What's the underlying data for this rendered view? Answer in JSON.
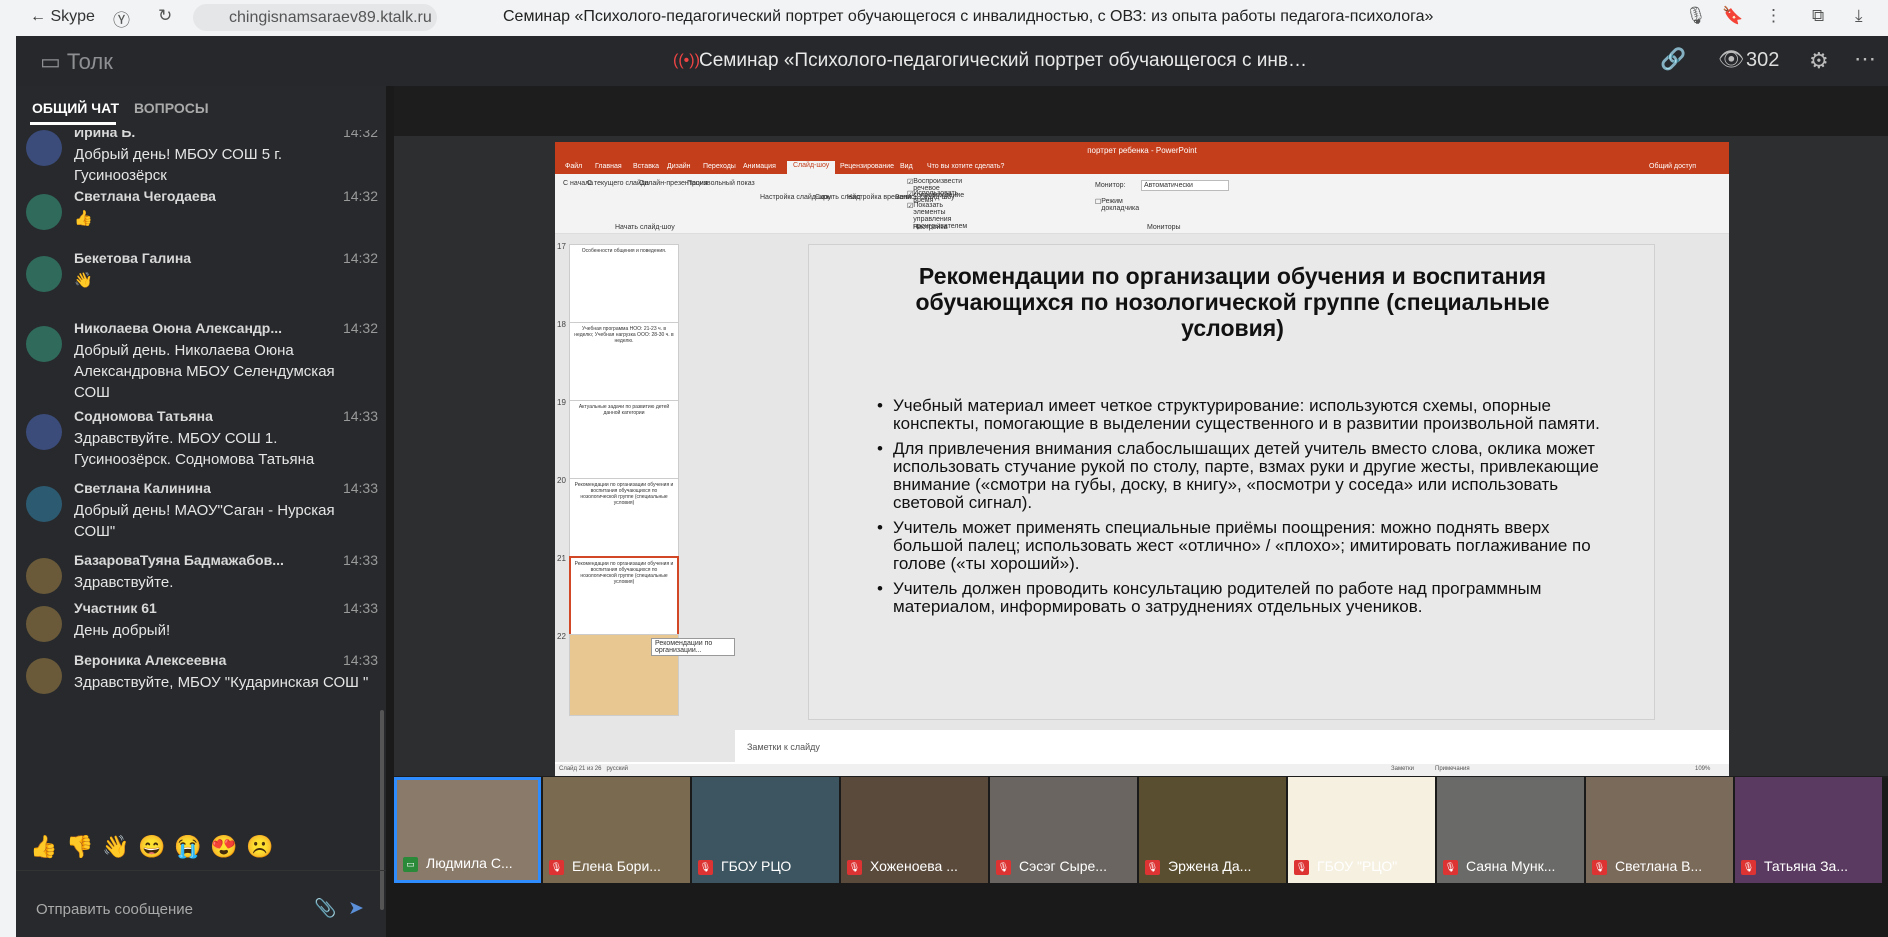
{
  "browser": {
    "back_label": "Skype",
    "url": "chingisnamsaraev89.ktalk.ru",
    "page_title": "Семинар «Психолого-педагогический портрет обучающегося с инвалидностью, с ОВЗ: из опыта работы педагога-психолога»"
  },
  "app": {
    "logo": "Толк",
    "conference_title": "Семинар «Психолого-педагогический портрет обучающегося с инв…",
    "viewers": "302"
  },
  "chat": {
    "tab_general": "ОБЩИЙ ЧАТ",
    "tab_questions": "ВОПРОСЫ",
    "messages": [
      {
        "name": "Ирина Б.",
        "time": "14:32",
        "text": "Добрый день! МБОУ СОШ 5 г. Гусиноозёрск",
        "color": "#3b4b7a"
      },
      {
        "name": "Светлана Чегодаева",
        "time": "14:32",
        "text": "👍",
        "color": "#2f6a5a"
      },
      {
        "name": "Бекетова Галина",
        "time": "14:32",
        "text": "👋",
        "color": "#2f6a5a"
      },
      {
        "name": "Николаева Оюна Александр...",
        "time": "14:32",
        "text": "Добрый день. Николаева Оюна Александровна МБОУ Селендумская СОШ",
        "color": "#2f6a5a"
      },
      {
        "name": "Содномова Татьяна",
        "time": "14:33",
        "text": "Здравствуйте. МБОУ СОШ 1. Гусиноозёрск. Содномова Татьяна",
        "color": "#3b4b7a"
      },
      {
        "name": "Светлана Калинина",
        "time": "14:33",
        "text": "Добрый день! МАОУ\"Саган - Нурская СОШ\"",
        "color": "#2c5a70"
      },
      {
        "name": "БазароваТуяна Бадмажабов...",
        "time": "14:33",
        "text": "Здравствуйте.",
        "color": "#6a5a3a"
      },
      {
        "name": "Участник 61",
        "time": "14:33",
        "text": "День добрый!",
        "color": "#6a5a3a"
      },
      {
        "name": "Вероника Алексеевна",
        "time": "14:33",
        "text": "Здравствуйте, МБОУ \"Кударинская СОШ \"",
        "color": "#6a5a3a"
      }
    ],
    "reactions": [
      "👍",
      "👎",
      "👋",
      "😄",
      "😭",
      "😍",
      "☹️"
    ],
    "input_placeholder": "Отправить сообщение"
  },
  "ppt": {
    "window_title": "портрет ребенка - PowerPoint",
    "tabs": [
      "Файл",
      "Главная",
      "Вставка",
      "Дизайн",
      "Переходы",
      "Анимация",
      "Слайд-шоу",
      "Рецензирование",
      "Вид",
      "Что вы хотите сделать?"
    ],
    "share": "Общий доступ",
    "ribbon_groups": [
      "Начать слайд-шоу",
      "Настройка",
      "Мониторы"
    ],
    "ribbon_items": [
      "С начала",
      "С текущего слайда",
      "Онлайн-презентация",
      "Произвольный показ",
      "Настройка слайд-шоу",
      "Скрыть слайд",
      "Настройка времени",
      "Запись слайд-шоу"
    ],
    "checks": [
      "Воспроизвести речевое сопровождение",
      "Использовать время",
      "Показать элементы управления проигрывателем"
    ],
    "monitor_label": "Монитор:",
    "monitor_value": "Автоматически",
    "presenter_mode": "Режим докладчика",
    "thumbs": [
      {
        "num": "17",
        "text": "Особенности общения и поведения."
      },
      {
        "num": "18",
        "text": "Учебная программа НОО: 21-23 ч. в неделю; Учебная нагрузка ООО: 28-30 ч. в неделю."
      },
      {
        "num": "19",
        "text": "Актуальные задачи по развитию детей данной категории"
      },
      {
        "num": "20",
        "text": "Рекомендации по организации обучения и воспитания обучающихся по нозологической группе (специальные условия)"
      },
      {
        "num": "21",
        "text": "Рекомендации по организации обучения и воспитания обучающихся по нозологической группе (специальные условия)"
      },
      {
        "num": "22",
        "text": ""
      }
    ],
    "tooltip": "Рекомендации по организации...",
    "slide_title": "Рекомендации по организации обучения и воспитания обучающихся по нозологической группе (специальные условия)",
    "bullets": [
      "Учебный материал имеет четкое структурирование: используются схемы, опорные конспекты, помогающие в выделении существенного и в развитии произвольной памяти.",
      "Для привлечения внимания слабослышащих детей учитель вместо слова, оклика может использовать стучание рукой по столу, парте, взмах руки и другие жесты, привлекающие внимание («смотри на губы, доску, в книгу», «посмотри у соседа» или использовать световой сигнал).",
      "Учитель может применять специальные приёмы поощрения: можно поднять вверх большой палец; использовать жест «отлично» / «плохо»; имитировать поглаживание по голове («ты хороший»).",
      "Учитель должен проводить консультацию родителей по работе над программным материалом, информировать о затруднениях отдельных учеников."
    ],
    "notes_placeholder": "Заметки к слайду",
    "status_left": "Слайд 21 из 26",
    "status_lang": "русский",
    "status_notes": "Заметки",
    "status_comments": "Примечания",
    "zoom": "109%"
  },
  "participants": [
    {
      "name": "Людмила С...",
      "mic": "on",
      "bg": "#8a7a6a",
      "highlight": true
    },
    {
      "name": "Елена Бори...",
      "mic": "off",
      "bg": "#7a6a50",
      "highlight": false
    },
    {
      "name": "ГБОУ РЦО",
      "mic": "off",
      "bg": "#3d5560",
      "highlight": false
    },
    {
      "name": "Хоженоева ...",
      "mic": "off",
      "bg": "#5a4a3c",
      "highlight": false
    },
    {
      "name": "Сэсэг Сыре...",
      "mic": "off",
      "bg": "#6a6560",
      "highlight": false
    },
    {
      "name": "Эржена Да...",
      "mic": "off",
      "bg": "#5a4e30",
      "highlight": false
    },
    {
      "name": "ГБОУ \"РЦО\"",
      "mic": "off",
      "bg": "#f5f0e0",
      "highlight": false
    },
    {
      "name": "Саяна Мунк...",
      "mic": "off",
      "bg": "#6a6a68",
      "highlight": false
    },
    {
      "name": "Светлана В...",
      "mic": "off",
      "bg": "#7a6a5a",
      "highlight": false
    },
    {
      "name": "Татьяна За...",
      "mic": "off",
      "bg": "#5a3a60",
      "highlight": false
    }
  ]
}
